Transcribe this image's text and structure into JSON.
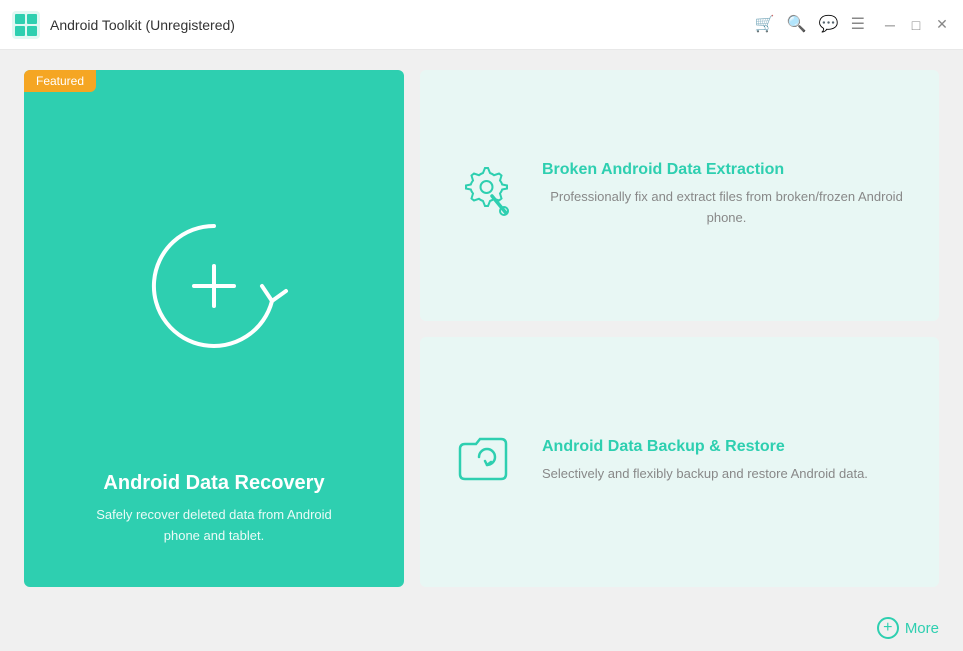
{
  "titlebar": {
    "title": "Android Toolkit (Unregistered)"
  },
  "featured_card": {
    "badge": "Featured",
    "title": "Android Data Recovery",
    "description": "Safely recover deleted data from Android phone and tablet."
  },
  "side_cards": [
    {
      "title": "Broken Android Data Extraction",
      "description": "Professionally fix and extract files from broken/frozen Android phone."
    },
    {
      "title": "Android Data Backup & Restore",
      "description": "Selectively and flexibly backup and restore Android data."
    }
  ],
  "footer": {
    "more_label": "More"
  },
  "colors": {
    "teal": "#2ecfb0",
    "orange": "#f5a623"
  }
}
